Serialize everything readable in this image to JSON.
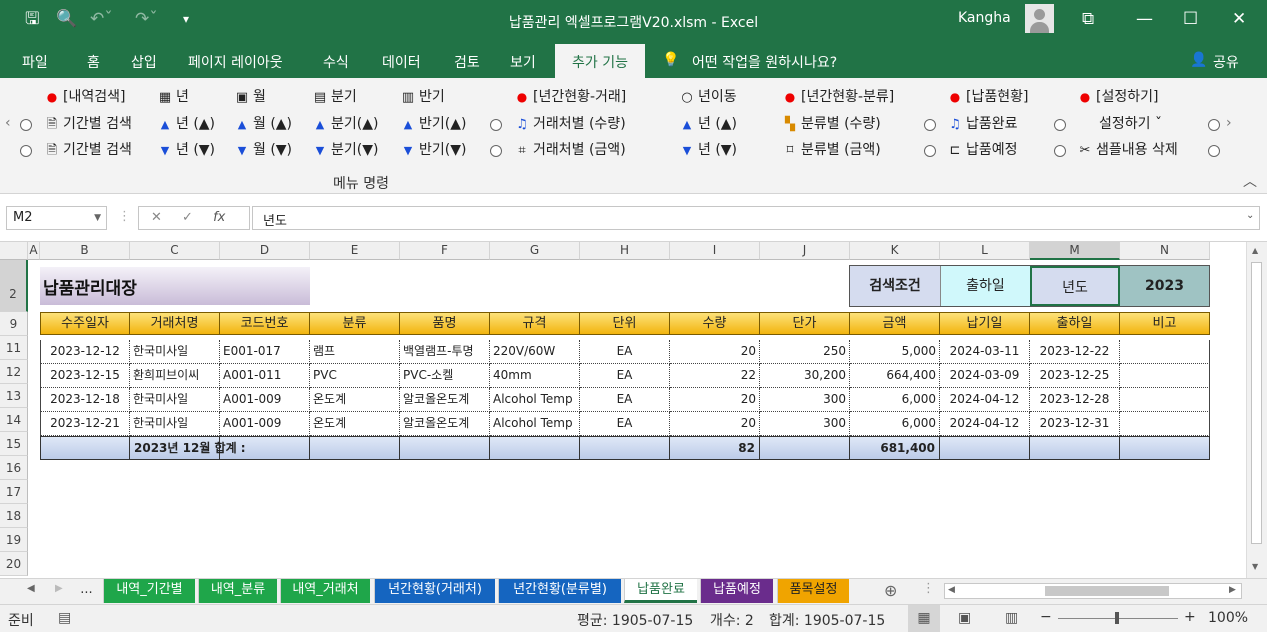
{
  "titlebar": {
    "title": "납품관리 엑셀프로그램V20.xlsm  -  Excel",
    "user": "Kangha"
  },
  "ribbon_tabs": [
    "파일",
    "홈",
    "삽입",
    "페이지 레이아웃",
    "수식",
    "데이터",
    "검토",
    "보기",
    "추가 기능"
  ],
  "active_tab": "추가 기능",
  "tell_me": "어떤 작업을 원하시나요?",
  "share": "공유",
  "ribbon": {
    "row1": [
      "[내역검색]",
      "년",
      "월",
      "분기",
      "반기",
      "[년간현황-거래]",
      "년이동",
      "[년간현황-분류]",
      "[납품현황]",
      "[설정하기]"
    ],
    "row2": [
      "기간별 검색",
      "년 (▲)",
      "월 (▲)",
      "분기(▲)",
      "반기(▲)",
      "거래처별 (수량)",
      "년 (▲)",
      "분류별 (수량)",
      "납품완료",
      "설정하기 ˇ"
    ],
    "row3": [
      "기간별 검색",
      "년 (▼)",
      "월 (▼)",
      "분기(▼)",
      "반기(▼)",
      "거래처별 (금액)",
      "년 (▼)",
      "분류별 (금액)",
      "납품예정",
      "샘플내용 삭제"
    ],
    "group_label": "메뉴 명령"
  },
  "formula_bar": {
    "name_box": "M2",
    "value": "년도"
  },
  "columns": [
    "A",
    "B",
    "C",
    "D",
    "E",
    "F",
    "G",
    "H",
    "I",
    "J",
    "K",
    "L",
    "M",
    "N"
  ],
  "rows": [
    "2",
    "9",
    "11",
    "12",
    "13",
    "14",
    "15",
    "16",
    "17",
    "18",
    "19",
    "20"
  ],
  "sheet": {
    "title": "납품관리대장",
    "search": {
      "label": "검색조건",
      "type": "출하일",
      "unit": "년도",
      "year": "2023"
    },
    "headers": [
      "수주일자",
      "거래처명",
      "코드번호",
      "분류",
      "품명",
      "규격",
      "단위",
      "수량",
      "단가",
      "금액",
      "납기일",
      "출하일",
      "비고"
    ],
    "data": [
      [
        "2023-12-12",
        "한국미사일",
        "E001-017",
        "램프",
        "백열램프-투명",
        "220V/60W",
        "EA",
        "20",
        "250",
        "5,000",
        "2024-03-11",
        "2023-12-22",
        ""
      ],
      [
        "2023-12-15",
        "환희피브이씨",
        "A001-011",
        "PVC",
        "PVC-소켈",
        "40mm",
        "EA",
        "22",
        "30,200",
        "664,400",
        "2024-03-09",
        "2023-12-25",
        ""
      ],
      [
        "2023-12-18",
        "한국미사일",
        "A001-009",
        "온도계",
        "알코올온도계",
        "Alcohol Temp",
        "EA",
        "20",
        "300",
        "6,000",
        "2024-04-12",
        "2023-12-28",
        ""
      ],
      [
        "2023-12-21",
        "한국미사일",
        "A001-009",
        "온도계",
        "알코올온도계",
        "Alcohol Temp",
        "EA",
        "20",
        "300",
        "6,000",
        "2024-04-12",
        "2023-12-31",
        ""
      ]
    ],
    "total": {
      "label": "2023년 12월 합계  :",
      "qty": "82",
      "amount": "681,400"
    }
  },
  "sheet_tabs": [
    "...",
    "내역_기간별",
    "내역_분류",
    "내역_거래처",
    "년간현황(거래처)",
    "년간현황(분류별)",
    "납품완료",
    "납품예정",
    "품목설정"
  ],
  "active_sheet": "납품완료",
  "sheet_tab_colors": [
    "#f1f1f1",
    "#1fa64a",
    "#1fa64a",
    "#1fa64a",
    "#1565c0",
    "#1565c0",
    "#ffffff",
    "#6a2c8c",
    "#f0a400"
  ],
  "status": {
    "ready": "준비",
    "average": "평균: 1905-07-15",
    "count": "개수: 2",
    "sum": "합계: 1905-07-15",
    "zoom": "100%"
  }
}
